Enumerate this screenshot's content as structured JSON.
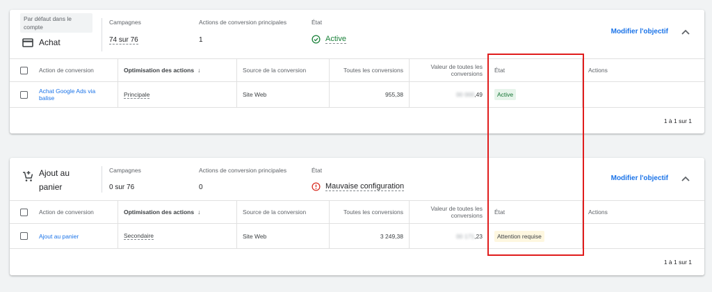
{
  "goals": [
    {
      "chip": "Par défaut dans le compte",
      "title": "Achat",
      "icon": "credit-card-icon",
      "campaigns_label": "Campagnes",
      "campaigns_value": "74 sur 76",
      "primary_label": "Actions de conversion principales",
      "primary_value": "1",
      "state_label": "État",
      "state_value": "Active",
      "state_icon": "check-circle-icon",
      "state_color": "#188038",
      "modify": "Modifier l'objectif",
      "columns": [
        "Action de conversion",
        "Optimisation des actions",
        "Source de la conversion",
        "Toutes les conversions",
        "Valeur de toutes les conversions",
        "État",
        "Actions"
      ],
      "rows": [
        {
          "name": "Achat Google Ads via balise",
          "optimization": "Principale",
          "source": "Site Web",
          "all_conversions": "955,38",
          "value_hidden": "00 000",
          "value_suffix": ",49",
          "status": "Active",
          "status_bg": "#e6f4ea",
          "status_color": "#137333"
        }
      ],
      "pagination": "1 à 1 sur 1"
    },
    {
      "title": "Ajout au panier",
      "icon": "add-shopping-cart-icon",
      "campaigns_label": "Campagnes",
      "campaigns_value": "0 sur 76",
      "primary_label": "Actions de conversion principales",
      "primary_value": "0",
      "state_label": "État",
      "state_value": "Mauvaise configuration",
      "state_icon": "error-icon",
      "state_color": "#d93025",
      "modify": "Modifier l'objectif",
      "columns": [
        "Action de conversion",
        "Optimisation des actions",
        "Source de la conversion",
        "Toutes les conversions",
        "Valeur de toutes les conversions",
        "État",
        "Actions"
      ],
      "rows": [
        {
          "name": "Ajout au panier",
          "optimization": "Secondaire",
          "source": "Site Web",
          "all_conversions": "3 249,38",
          "value_hidden": "00 171",
          "value_suffix": ",23",
          "status": "Attention requise",
          "status_bg": "#fef7e0",
          "status_color": "#3c4043"
        }
      ],
      "pagination": "1 à 1 sur 1"
    }
  ],
  "highlight_color": "#e01b1b"
}
